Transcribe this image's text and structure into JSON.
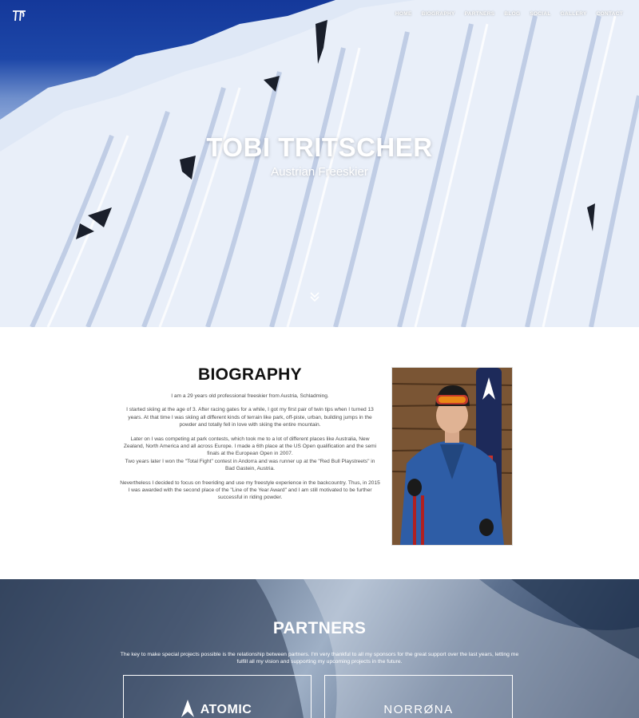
{
  "nav": {
    "items": [
      "HOME",
      "BIOGRAPHY",
      "PARTNERS",
      "BLOG",
      "SOCIAL",
      "GALLERY",
      "CONTACT"
    ]
  },
  "logo": {
    "text": "TT"
  },
  "hero": {
    "title": "TOBI TRITSCHER",
    "subtitle": "Austrian Freeskier"
  },
  "biography": {
    "title": "BIOGRAPHY",
    "paragraphs": [
      "I am a 29 years old professional freeskier from Austria, Schladming.",
      "I started skiing at the age of 3. After racing gates for a while, I got my first pair of twin tips when I turned 13 years. At that time I was skiing all different kinds of terrain like park, off-piste, urban, building jumps in the powder and totally fell in love with skiing the entire mountain.",
      "Later on I was competing at park contests, which took me to a lot of different places like Australia, New Zealand, North America and all across Europe. I made a 6th place at the US Open qualification and the semi finals at the European Open in 2007.",
      "Two years later I won the \"Total Fight\" contest in Andorra and was runner up at the \"Red Bull Playstreets\" in Bad Gastein, Austria.",
      "Nevertheless I decided to focus on freeriding and use my freestyle experience in the backcountry. Thus, in 2015 I was awarded with the second place of the \"Line of the Year Award\" and I am still motivated to be further successful in riding powder."
    ]
  },
  "partners": {
    "title": "PARTNERS",
    "text": "The key to make special projects possible is the relationship between partners. I'm very thankful to all my sponsors for the great support over the last years, letting me fulfill all my vision and supporting my upcoming projects in the future.",
    "items": [
      "ATOMIC",
      "NORRØNA"
    ]
  },
  "colors": {
    "sky": "#1d47a8",
    "text_dark": "#111111",
    "text_body": "#4a4a4a"
  }
}
